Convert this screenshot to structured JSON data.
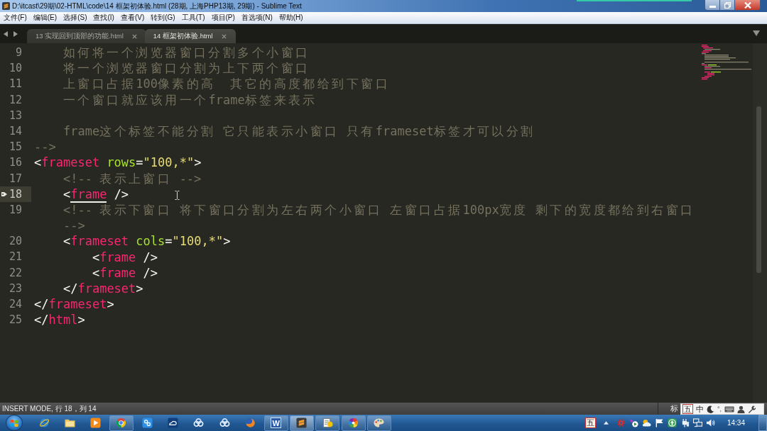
{
  "window": {
    "title": "D:\\itcast\\29期\\02-HTML\\code\\14 框架初体验.html (28期, 上海PHP13期, 29期) - Sublime Text"
  },
  "menu": [
    "文件(F)",
    "编辑(E)",
    "选择(S)",
    "查找(I)",
    "查看(V)",
    "转到(G)",
    "工具(T)",
    "项目(P)",
    "首选项(N)",
    "帮助(H)"
  ],
  "tabs": [
    {
      "label": "13 实现回到顶部的功能.html",
      "selected": false
    },
    {
      "label": "14 框架初体验.html",
      "selected": true
    }
  ],
  "editor": {
    "lines": [
      {
        "number": "9",
        "current": false,
        "bookmarked": false,
        "tokens": [
          {
            "kind": "comment",
            "text": "    如何将一个浏览器窗口分割多个小窗口"
          }
        ]
      },
      {
        "number": "10",
        "current": false,
        "bookmarked": false,
        "tokens": [
          {
            "kind": "comment",
            "text": "    将一个浏览器窗口分割为上下两个窗口"
          }
        ]
      },
      {
        "number": "11",
        "current": false,
        "bookmarked": false,
        "tokens": [
          {
            "kind": "comment",
            "text": "    上窗口占据100像素的高  其它的高度都给到下窗口"
          }
        ]
      },
      {
        "number": "12",
        "current": false,
        "bookmarked": false,
        "tokens": [
          {
            "kind": "comment",
            "text": "    一个窗口就应该用一个frame标签来表示"
          }
        ]
      },
      {
        "number": "13",
        "current": false,
        "bookmarked": false
      },
      {
        "number": "14",
        "current": false,
        "bookmarked": false,
        "tokens": [
          {
            "kind": "comment",
            "text": "    frame这个标签不能分割 它只能表示小窗口 只有frameset标签才可以分割"
          }
        ]
      },
      {
        "number": "15",
        "current": false,
        "bookmarked": false,
        "tokens": [
          {
            "kind": "comment",
            "text": "-->"
          }
        ]
      },
      {
        "number": "16",
        "current": false,
        "bookmarked": false,
        "tokens": [
          {
            "kind": "punct",
            "text": "<"
          },
          {
            "kind": "tag",
            "text": "frameset"
          },
          {
            "kind": "attr",
            "text": " rows"
          },
          {
            "kind": "punct",
            "text": "="
          },
          {
            "kind": "string",
            "text": "\"100,*\""
          },
          {
            "kind": "punct",
            "text": ">"
          }
        ]
      },
      {
        "number": "17",
        "current": false,
        "bookmarked": false,
        "tokens": [
          {
            "kind": "comment",
            "text": "    <!-- 表示上窗口 -->"
          }
        ]
      },
      {
        "number": "18",
        "current": true,
        "bookmarked": true,
        "tokens": [
          {
            "kind": "punct",
            "text": "    <"
          },
          {
            "kind": "matched-tag",
            "text": "frame"
          },
          {
            "kind": "punct",
            "text": " />"
          }
        ]
      },
      {
        "number": "19",
        "current": false,
        "bookmarked": false,
        "tokens": [
          {
            "kind": "comment",
            "text": "    <!-- 表示下窗口 将下窗口分割为左右两个小窗口 左窗口占据100px宽度 剩下的宽度都给到右窗口"
          }
        ],
        "wrap": [
          {
            "kind": "comment",
            "text": "-->"
          }
        ]
      },
      {
        "number": "20",
        "current": false,
        "bookmarked": false,
        "tokens": [
          {
            "kind": "punct",
            "text": "    <"
          },
          {
            "kind": "tag",
            "text": "frameset"
          },
          {
            "kind": "attr",
            "text": " cols"
          },
          {
            "kind": "punct",
            "text": "="
          },
          {
            "kind": "string",
            "text": "\"100,*\""
          },
          {
            "kind": "punct",
            "text": ">"
          }
        ]
      },
      {
        "number": "21",
        "current": false,
        "bookmarked": false,
        "tokens": [
          {
            "kind": "punct",
            "text": "        <"
          },
          {
            "kind": "tag",
            "text": "frame"
          },
          {
            "kind": "punct",
            "text": " />"
          }
        ]
      },
      {
        "number": "22",
        "current": false,
        "bookmarked": false,
        "tokens": [
          {
            "kind": "punct",
            "text": "        <"
          },
          {
            "kind": "tag",
            "text": "frame"
          },
          {
            "kind": "punct",
            "text": " />"
          }
        ]
      },
      {
        "number": "23",
        "current": false,
        "bookmarked": false,
        "tokens": [
          {
            "kind": "punct",
            "text": "    </"
          },
          {
            "kind": "tag",
            "text": "frameset"
          },
          {
            "kind": "punct",
            "text": ">"
          }
        ]
      },
      {
        "number": "24",
        "current": false,
        "bookmarked": false,
        "tokens": [
          {
            "kind": "punct",
            "text": "</"
          },
          {
            "kind": "tag",
            "text": "frameset"
          },
          {
            "kind": "punct",
            "text": ">"
          }
        ]
      },
      {
        "number": "25",
        "current": false,
        "bookmarked": false,
        "tokens": [
          {
            "kind": "punct",
            "text": "</"
          },
          {
            "kind": "tag",
            "text": "html"
          },
          {
            "kind": "punct",
            "text": ">"
          }
        ]
      }
    ]
  },
  "status_bar": {
    "text": "INSERT MODE, 行 18，列 14",
    "right_text": "标"
  },
  "ime_bar": {
    "mode": "五",
    "language": "中",
    "punctuation": "°,"
  },
  "taskbar": {
    "apps": [
      {
        "running": false,
        "selected": false
      },
      {
        "running": false,
        "selected": false
      },
      {
        "running": false,
        "selected": false
      },
      {
        "running": true,
        "selected": false
      },
      {
        "running": false,
        "selected": false
      },
      {
        "running": false,
        "selected": false
      },
      {
        "running": false,
        "selected": false
      },
      {
        "running": false,
        "selected": false
      },
      {
        "running": false,
        "selected": false
      },
      {
        "glyph": "W",
        "running": true,
        "selected": false
      },
      {
        "running": true,
        "selected": true
      },
      {
        "running": true,
        "selected": false
      },
      {
        "running": true,
        "selected": false
      },
      {
        "running": true,
        "selected": false
      }
    ],
    "tray": {
      "ime": "五",
      "clock": "14:34"
    }
  }
}
